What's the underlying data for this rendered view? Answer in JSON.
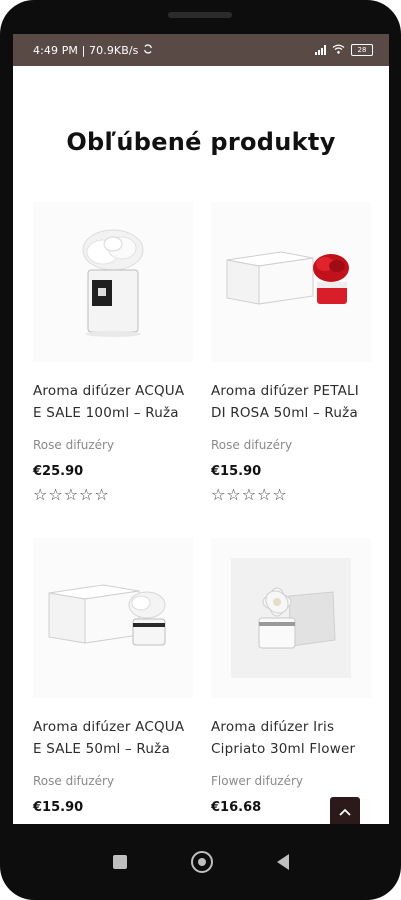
{
  "status": {
    "time_speed": "4:49 PM | 70.9KB/s",
    "sync_icon": "sync-icon",
    "battery": "28"
  },
  "page": {
    "title": "Obľúbené produkty"
  },
  "products": [
    {
      "name": "Aroma difúzer ACQUA E SALE 100ml – Ruža",
      "category": "Rose difuzéry",
      "price": "€25.90",
      "rating": 0,
      "image": "white-rose-diffuser-bottle"
    },
    {
      "name": "Aroma difúzer PETALI DI ROSA 50ml – Ruža",
      "category": "Rose difuzéry",
      "price": "€15.90",
      "rating": 0,
      "image": "red-rose-diffuser-with-box"
    },
    {
      "name": "Aroma difúzer ACQUA E SALE 50ml – Ruža",
      "category": "Rose difuzéry",
      "price": "€15.90",
      "rating": 0,
      "image": "white-rose-diffuser-with-box"
    },
    {
      "name": "Aroma difúzer Iris Cipriato 30ml Flower",
      "category": "Flower difuzéry",
      "price": "€16.68",
      "rating": 0,
      "image": "white-flower-diffuser-with-box"
    }
  ],
  "ui": {
    "back_to_top_icon": "chevron-up-icon"
  },
  "colors": {
    "status_bar": "#5a4a45",
    "back_to_top": "#2b1a19",
    "title": "#111111"
  }
}
